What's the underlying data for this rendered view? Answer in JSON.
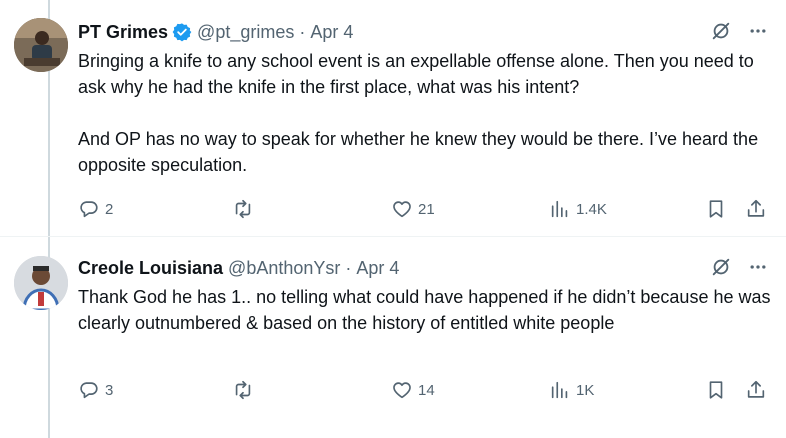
{
  "tweets": [
    {
      "name": "PT Grimes",
      "handle": "@pt_grimes",
      "separator": "·",
      "date": "Apr 4",
      "text": "Bringing a knife to any school event is an expellable offense alone. Then you need to ask why he had the knife in the first place, what was his intent?\n\nAnd OP has no way to speak for whether he knew they would be there. I’ve heard the opposite speculation.",
      "replies": "2",
      "retweets": "",
      "likes": "21",
      "views": "1.4K",
      "verified": true
    },
    {
      "name": "Creole Louisiana",
      "handle": "@bAnthonYsr",
      "separator": "·",
      "date": "Apr 4",
      "text": "Thank God he has 1.. no telling what could have happened if he didn’t because he was clearly outnumbered & based on the history of entitled white people",
      "replies": "3",
      "retweets": "",
      "likes": "14",
      "views": "1K",
      "verified": false
    }
  ],
  "colors": {
    "accent": "#1d9bf0",
    "muted": "#536471",
    "text": "#0f1419"
  },
  "icons": [
    "grok-icon",
    "more-icon",
    "reply-icon",
    "retweet-icon",
    "like-icon",
    "views-icon",
    "bookmark-icon",
    "share-icon",
    "verified-badge-icon"
  ]
}
